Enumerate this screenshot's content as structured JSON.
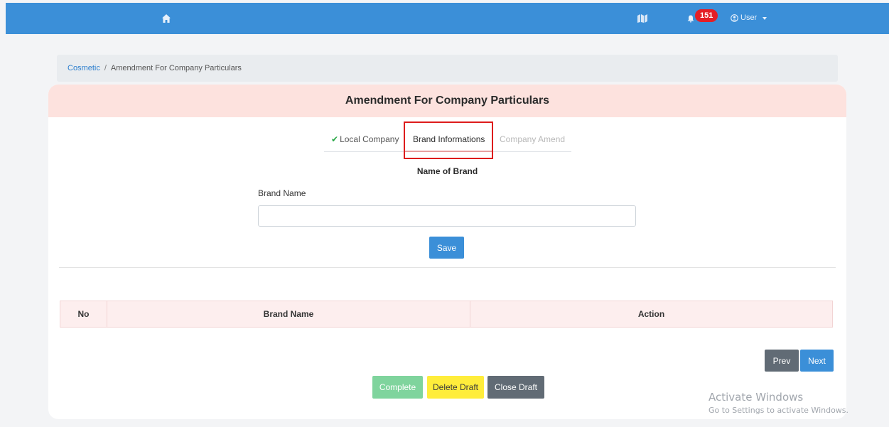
{
  "navbar": {
    "home_icon": "home-icon",
    "book_icon": "book-map-icon",
    "bell_icon": "bell-icon",
    "notification_count": "151",
    "user_icon": "user-circle-icon",
    "user_label": "User",
    "colors": {
      "bar": "#3b8fd8",
      "badge": "#e41e26"
    }
  },
  "breadcrumb": {
    "items": [
      "Cosmetic",
      "Amendment For Company Particulars"
    ],
    "separator": "/"
  },
  "card": {
    "title": "Amendment For Company Particulars",
    "header_color": "#fde2de"
  },
  "tabs": [
    {
      "label": "Local Company",
      "state": "completed",
      "icon": "check-icon"
    },
    {
      "label": "Brand Informations",
      "state": "active"
    },
    {
      "label": "Company Amend",
      "state": "disabled"
    }
  ],
  "form": {
    "section_title": "Name of Brand",
    "brand_name_label": "Brand Name",
    "brand_name_value": "",
    "brand_name_placeholder": "",
    "save_label": "Save"
  },
  "table": {
    "columns": [
      "No",
      "Brand Name",
      "Action"
    ],
    "rows": []
  },
  "pagination": {
    "prev_label": "Prev",
    "next_label": "Next"
  },
  "actions": {
    "complete_label": "Complete",
    "delete_draft_label": "Delete Draft",
    "close_draft_label": "Close Draft"
  },
  "watermark": {
    "title": "Activate Windows",
    "subtitle": "Go to Settings to activate Windows."
  }
}
